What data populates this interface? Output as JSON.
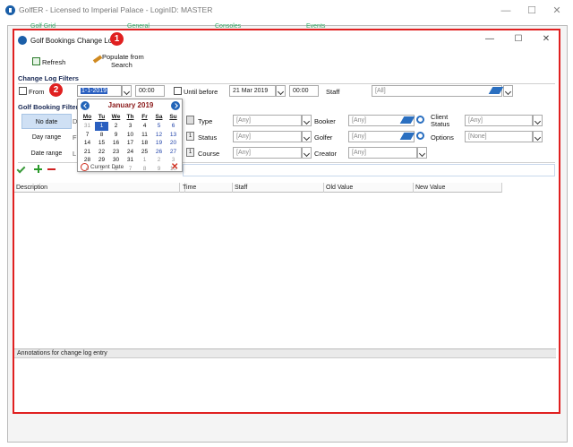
{
  "outer_window": {
    "title": "GolfER - Licensed to Imperial Palace - LoginID: MASTER",
    "tabs": [
      "Golf Grid",
      "General",
      "Consoles",
      "Events"
    ],
    "minimize": "—",
    "maximize": "☐",
    "close": "✕"
  },
  "child_window": {
    "title": "Golf Bookings Change Log",
    "badge": "1",
    "minimize": "—",
    "maximize": "☐",
    "close": "✕"
  },
  "toolbar": {
    "refresh_label": "Refresh",
    "populate_label_1": "Populate from",
    "populate_label_2": "Search"
  },
  "change_log_filters": {
    "title": "Change Log Filters",
    "from_label": "From",
    "from_checked": false,
    "badge": "2",
    "from_date": "1-1-2019",
    "from_time": "00:00",
    "until_label": "Until before",
    "until_checked": false,
    "until_date": "21 Mar 2019",
    "until_time": "00:00",
    "staff_label": "Staff",
    "staff_value": "[All]"
  },
  "golf_booking_filters": {
    "title": "Golf Booking Filters",
    "side_buttons": [
      "No date",
      "Day range",
      "Date range"
    ],
    "side_letters": [
      "D",
      "F",
      "L"
    ],
    "type_label": "Type",
    "type_value": "[Any]",
    "status_label": "Status",
    "status_value": "[Any]",
    "course_label": "Course",
    "course_value": "[Any]",
    "booker_label": "Booker",
    "booker_value": "[Any]",
    "golfer_label": "Golfer",
    "golfer_value": "[Any]",
    "creator_label": "Creator",
    "creator_value": "[Any]",
    "client_status_label_1": "Client",
    "client_status_label_2": "Status",
    "client_status_value": "[Any]",
    "options_label": "Options",
    "options_value": "[None]"
  },
  "calendar": {
    "month": "January 2019",
    "days_of_week": [
      "Mo",
      "Tu",
      "We",
      "Th",
      "Fr",
      "Sa",
      "Su"
    ],
    "weeks": [
      [
        "31",
        "1",
        "2",
        "3",
        "4",
        "5",
        "6"
      ],
      [
        "7",
        "8",
        "9",
        "10",
        "11",
        "12",
        "13"
      ],
      [
        "14",
        "15",
        "16",
        "17",
        "18",
        "19",
        "20"
      ],
      [
        "21",
        "22",
        "23",
        "24",
        "25",
        "26",
        "27"
      ],
      [
        "28",
        "29",
        "30",
        "31",
        "1",
        "2",
        "3"
      ],
      [
        "4",
        "5",
        "6",
        "7",
        "8",
        "9",
        "10"
      ]
    ],
    "current_date_label": "Current Date"
  },
  "grid": {
    "columns": [
      "Description",
      "",
      "Time",
      "Staff",
      "Old Value",
      "New Value"
    ]
  },
  "annotations_label": "Annotations for change log entry",
  "colors": {
    "accent_red": "#e02020",
    "selection_blue": "#2a5fc0",
    "month_red": "#8b1a1a",
    "section_navy": "#1a2a55"
  }
}
